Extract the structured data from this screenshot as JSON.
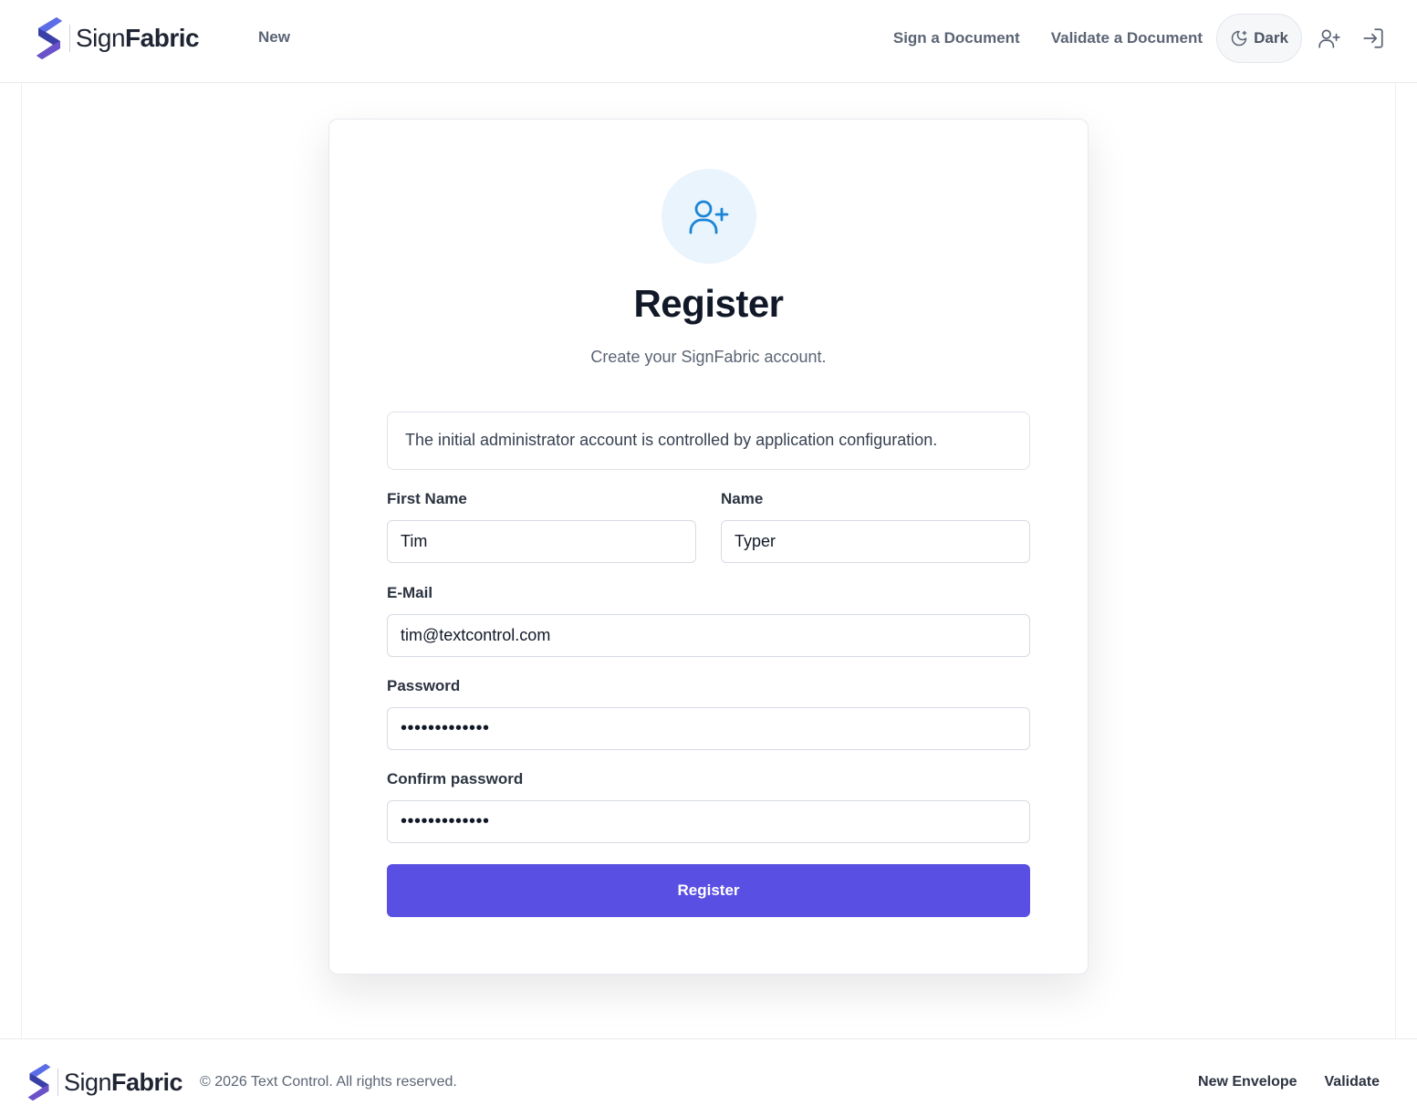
{
  "header": {
    "brand": {
      "light": "Sign",
      "bold": "Fabric"
    },
    "nav_left": [
      {
        "label": "New"
      }
    ],
    "nav_right": [
      {
        "label": "Sign a Document"
      },
      {
        "label": "Validate a Document"
      }
    ],
    "theme_toggle": {
      "label": "Dark",
      "icon": "moon-stars-icon"
    },
    "icons": [
      "user-plus-icon",
      "sign-in-icon"
    ]
  },
  "card": {
    "icon": "user-plus-icon",
    "title": "Register",
    "subtitle": "Create your SignFabric account.",
    "notice": "The initial administrator account is controlled by application configuration.",
    "fields": {
      "first_name": {
        "label": "First Name",
        "value": "Tim"
      },
      "name": {
        "label": "Name",
        "value": "Typer"
      },
      "email": {
        "label": "E-Mail",
        "value": "tim@textcontrol.com"
      },
      "password": {
        "label": "Password",
        "value": "•••••••••••••"
      },
      "confirm_password": {
        "label": "Confirm password",
        "value": "•••••••••••••"
      }
    },
    "submit_label": "Register"
  },
  "footer": {
    "brand": {
      "light": "Sign",
      "bold": "Fabric"
    },
    "copyright": "© 2026 Text Control. All rights reserved.",
    "links": [
      {
        "label": "New Envelope"
      },
      {
        "label": "Validate"
      }
    ]
  },
  "colors": {
    "accent": "#5a4fe3",
    "icon_blue": "#1a85d6",
    "icon_bg": "#eaf4fd",
    "muted_text": "#5b6474"
  }
}
